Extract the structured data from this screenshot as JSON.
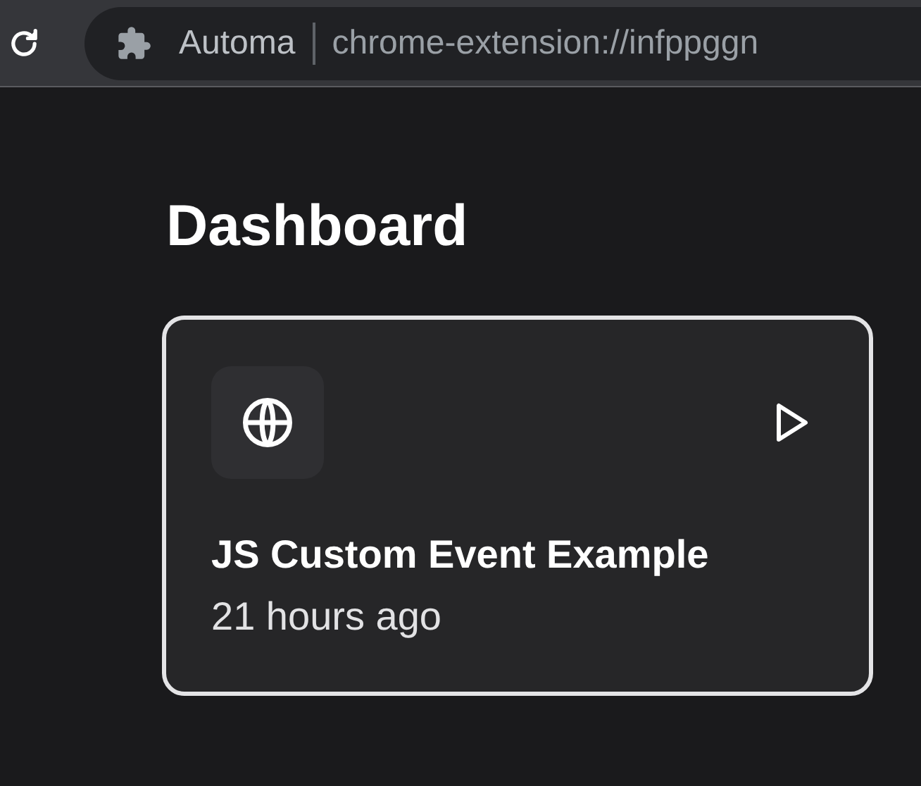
{
  "browser": {
    "extension_name": "Automa",
    "url": "chrome-extension://infppggn"
  },
  "page": {
    "title": "Dashboard"
  },
  "workflows": [
    {
      "name": "JS Custom Event Example",
      "updated": "21 hours ago"
    }
  ]
}
